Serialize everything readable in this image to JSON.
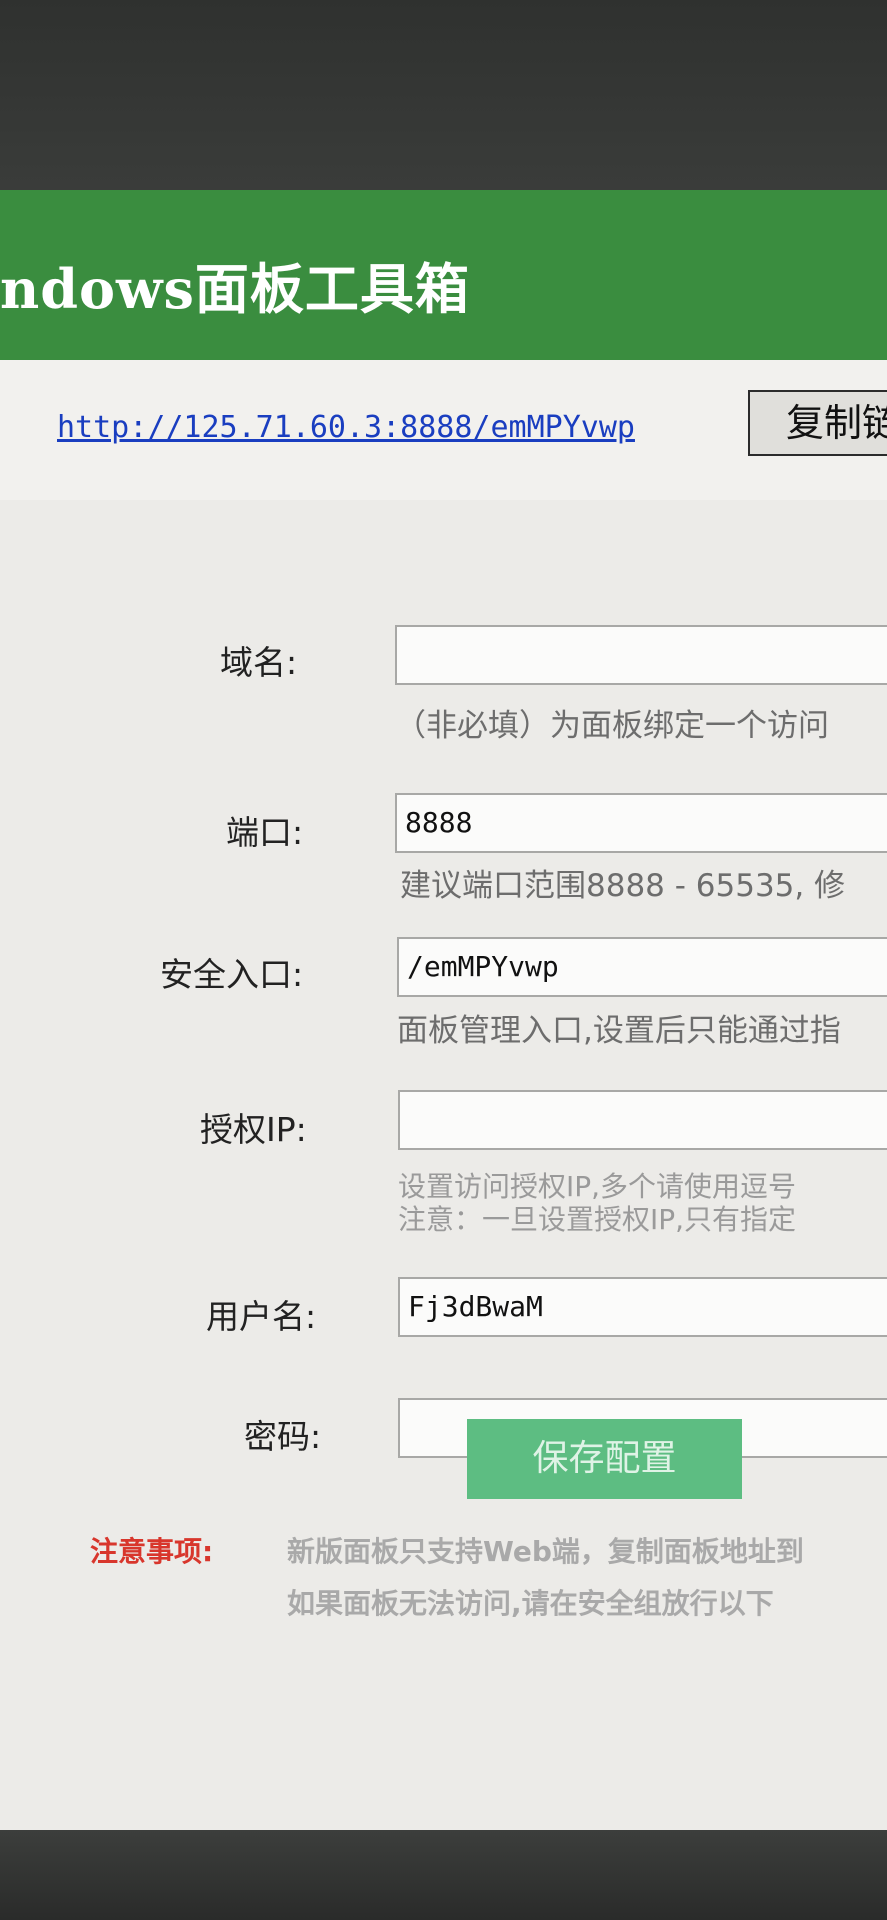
{
  "window": {
    "title": "ndows面板工具箱"
  },
  "url_row": {
    "panel_url": "http://125.71.60.3:8888/emMPYvwp",
    "copy_button_label": "复制链"
  },
  "form": {
    "domain": {
      "label": "域名:",
      "value": "",
      "hint": "（非必填）为面板绑定一个访问"
    },
    "port": {
      "label": "端口:",
      "value": "8888",
      "hint": "建议端口范围8888 - 65535, 修"
    },
    "security_entry": {
      "label": "安全入口:",
      "value": "/emMPYvwp",
      "hint": "面板管理入口,设置后只能通过指"
    },
    "auth_ip": {
      "label": "授权IP:",
      "value": "",
      "hint_line1": "设置访问授权IP,多个请使用逗号",
      "hint_line2": "注意：一旦设置授权IP,只有指定"
    },
    "username": {
      "label": "用户名:",
      "value": "Fj3dBwaM"
    },
    "password": {
      "label": "密码:",
      "value": ""
    },
    "save_button_label": "保存配置"
  },
  "notice": {
    "label": "注意事项:",
    "line1": "新版面板只支持Web端，复制面板地址到",
    "line2": "如果面板无法访问,请在安全组放行以下"
  }
}
